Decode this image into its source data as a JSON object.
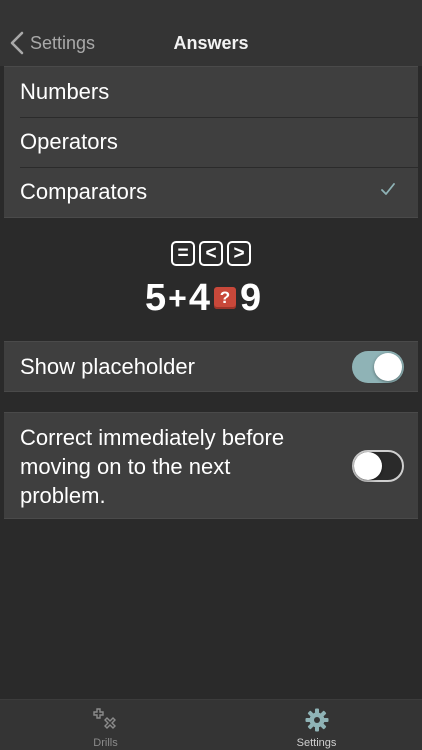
{
  "nav": {
    "back_label": "Settings",
    "title": "Answers"
  },
  "answer_types": [
    {
      "label": "Numbers",
      "selected": false
    },
    {
      "label": "Operators",
      "selected": false
    },
    {
      "label": "Comparators",
      "selected": true
    }
  ],
  "preview": {
    "comparators": [
      "=",
      "<",
      ">"
    ],
    "left": "5",
    "operator": "+",
    "right": "4",
    "placeholder": "?",
    "result": "9"
  },
  "options": {
    "show_placeholder": {
      "label": "Show placeholder",
      "on": true
    },
    "correct_immediately": {
      "line1": "Correct immediately before",
      "line2": "moving on to the next",
      "line3": "problem.",
      "on": false
    }
  },
  "tabs": [
    {
      "label": "Drills",
      "active": false,
      "icon": "plus-times-icon"
    },
    {
      "label": "Settings",
      "active": true,
      "icon": "gear-icon"
    }
  ],
  "colors": {
    "accent": "#8fb3b6",
    "check": "#8fb3b6",
    "placeholder_bg": "#c8483a"
  }
}
